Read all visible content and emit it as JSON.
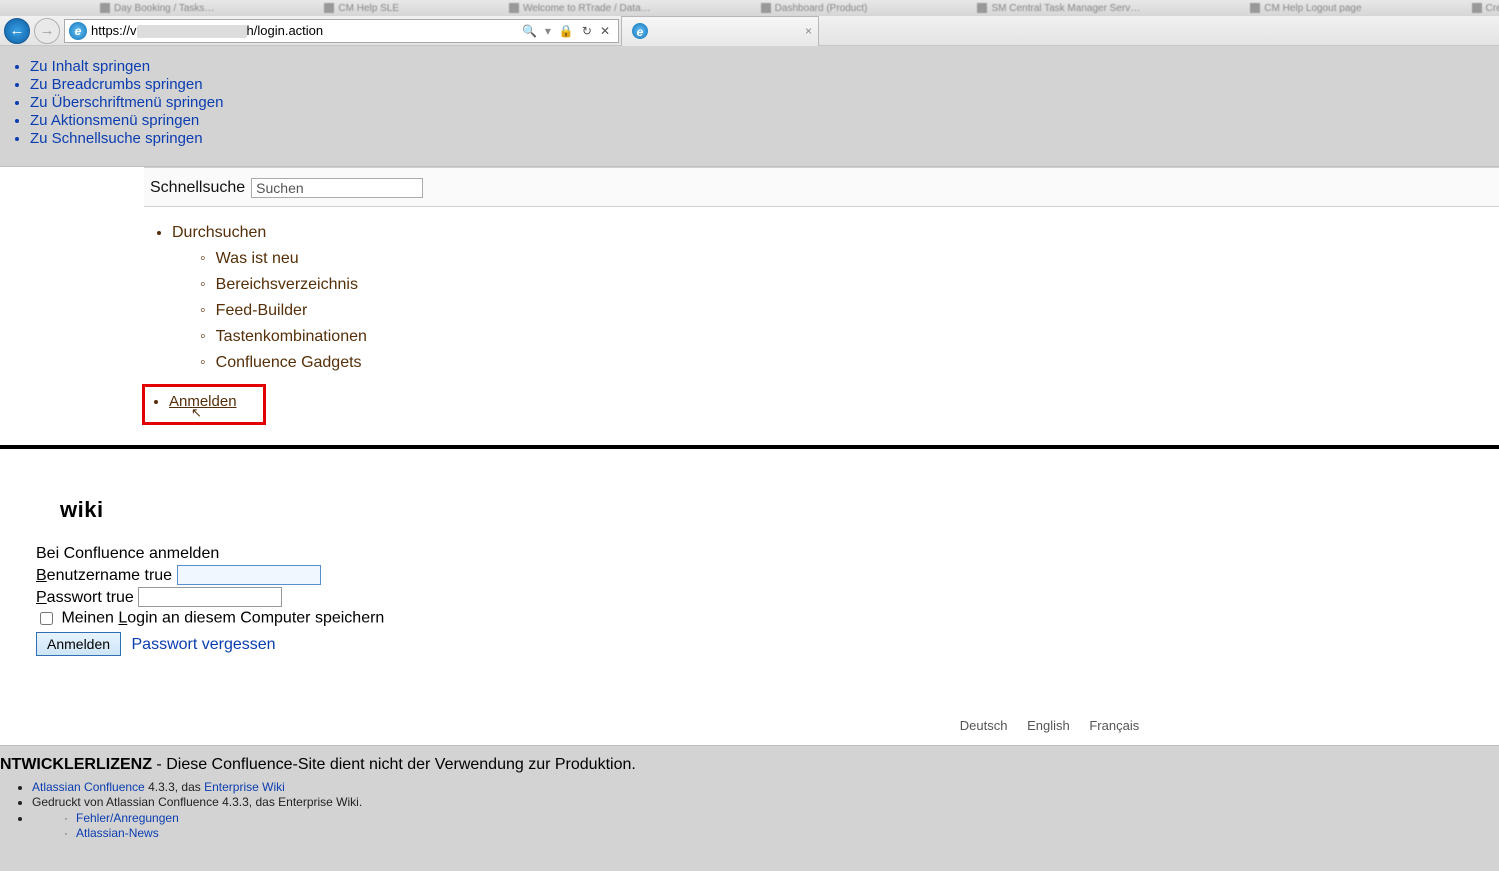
{
  "taskbar": {
    "items": [
      "Day Booking / Tasks…",
      "CM Help SLE",
      "Welcome to RTrade / Data…",
      "Dashboard (Product)",
      "SM Central Task Manager Serv…",
      "CM Help Logout page",
      "Create Issue – Atlassian C…"
    ]
  },
  "browser": {
    "url_prefix": "https://v",
    "url_suffix": "h/login.action",
    "search_glyph": "🔍",
    "lock_glyph": "🔒",
    "refresh_glyph": "↻",
    "stop_glyph": "✕",
    "tab_close": "×"
  },
  "skip_links": [
    "Zu Inhalt springen",
    "Zu Breadcrumbs springen",
    "Zu Überschriftmenü springen",
    "Zu Aktionsmenü springen",
    "Zu Schnellsuche springen"
  ],
  "quicksearch": {
    "label": "Schnellsuche",
    "placeholder": "Suchen"
  },
  "browse_menu": {
    "root": "Durchsuchen",
    "items": [
      "Was ist neu",
      "Bereichsverzeichnis",
      "Feed-Builder",
      "Tastenkombinationen",
      "Confluence Gadgets"
    ],
    "login": "Anmelden"
  },
  "login": {
    "site_title": "wiki",
    "heading": "Bei Confluence anmelden",
    "username_label_pre": "B",
    "username_label_rest": "enutzername true",
    "password_label_pre": "P",
    "password_label_rest": "asswort true",
    "remember_pre": "Meinen ",
    "remember_u": "L",
    "remember_rest": "ogin an diesem Computer speichern",
    "submit": "Anmelden",
    "forgot": "Passwort vergessen"
  },
  "languages": [
    "Deutsch",
    "English",
    "Français"
  ],
  "footer": {
    "dev_bold": "NTWICKLERLIZENZ",
    "dev_rest": " - Diese Confluence-Site dient nicht der Verwendung zur Produktion.",
    "line1_a": "Atlassian Confluence",
    "line1_b": " 4.3.3, das ",
    "line1_c": "Enterprise Wiki",
    "line2": "Gedruckt von Atlassian Confluence 4.3.3, das Enterprise Wiki.",
    "sub1": "Fehler/Anregungen",
    "sub2": "Atlassian-News"
  }
}
